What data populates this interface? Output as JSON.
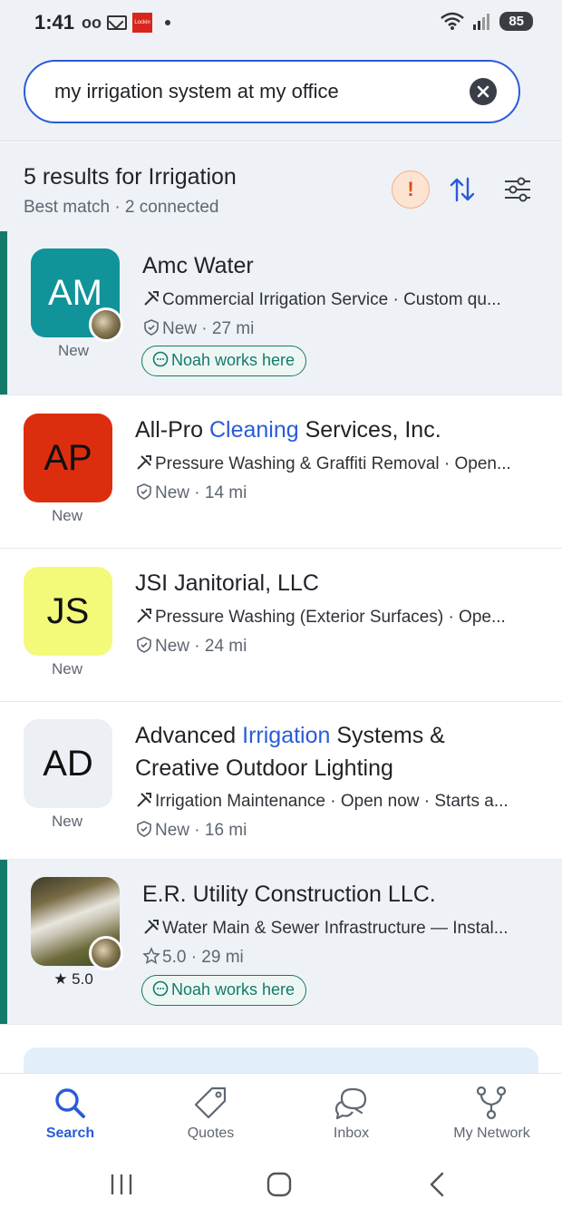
{
  "status_bar": {
    "time": "1:41",
    "app_icon_text": "Lockin",
    "battery": "85"
  },
  "search": {
    "query": "my irrigation system at my office"
  },
  "results": {
    "title": "5 results for Irrigation",
    "subtitle": "Best match · 2 connected",
    "alert_glyph": "!"
  },
  "cards": [
    {
      "initials": "AM",
      "avatar_bg": "#11939a",
      "avatar_fg": "#ffffff",
      "caption": "New",
      "name_parts": [
        "Amc Water"
      ],
      "detail": "Commercial Irrigation Service · Custom qu...",
      "meta": "New · 27 mi",
      "chip": "Noah works here"
    },
    {
      "initials": "AP",
      "avatar_bg": "#dc2d0f",
      "avatar_fg": "#111111",
      "caption": "New",
      "name_before": "All-Pro ",
      "name_highlight": "Cleaning",
      "name_after": " Services, Inc.",
      "detail": "Pressure Washing & Graffiti Removal · Open...",
      "meta": "New · 14 mi"
    },
    {
      "initials": "JS",
      "avatar_bg": "#f3fa7a",
      "avatar_fg": "#111111",
      "caption": "New",
      "name": "JSI Janitorial, LLC",
      "detail": "Pressure Washing (Exterior Surfaces) · Ope...",
      "meta": "New · 24 mi"
    },
    {
      "initials": "AD",
      "avatar_bg": "#eceff3",
      "avatar_fg": "#111111",
      "caption": "New",
      "name_before": "Advanced ",
      "name_highlight": "Irrigation",
      "name_after": " Systems &",
      "name_line2": "Creative Outdoor Lighting",
      "detail": "Irrigation Maintenance · Open now · Starts a...",
      "meta": "New · 16 mi"
    },
    {
      "caption": "★ 5.0",
      "name": "E.R. Utility Construction LLC.",
      "detail": "Water Main & Sewer Infrastructure — Instal...",
      "meta": "5.0 · 29 mi",
      "chip": "Noah works here"
    }
  ],
  "bottom_nav": [
    {
      "label": "Search",
      "icon": "search-icon",
      "active": true
    },
    {
      "label": "Quotes",
      "icon": "tag-icon"
    },
    {
      "label": "Inbox",
      "icon": "chat-bubbles-icon"
    },
    {
      "label": "My Network",
      "icon": "network-icon"
    }
  ],
  "colors": {
    "accent": "#2a5bd7",
    "connected": "#137a6b",
    "alert": "#d2541c"
  }
}
